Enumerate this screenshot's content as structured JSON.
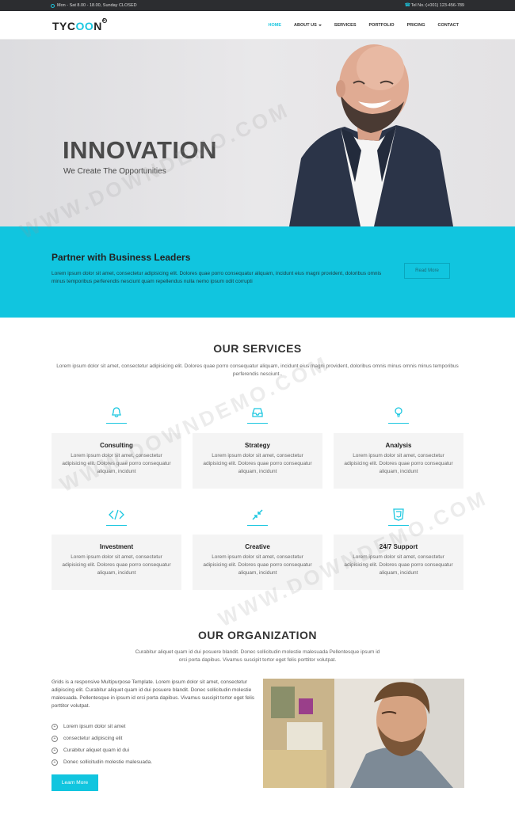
{
  "topbar": {
    "hours": "Mon - Sat 8.00 - 18.00, Sunday CLOSED",
    "phone": "Tel No.:(+001) 123-456-789"
  },
  "brand": {
    "pre": "TYC",
    "accent": "OO",
    "post": "N",
    "reg": "R"
  },
  "nav": [
    {
      "label": "HOME",
      "active": true
    },
    {
      "label": "ABOUT US"
    },
    {
      "label": "SERVICES"
    },
    {
      "label": "PORTFOLIO"
    },
    {
      "label": "PRICING"
    },
    {
      "label": "CONTACT"
    }
  ],
  "hero": {
    "title": "INNOVATION",
    "subtitle": "We Create The Opportunities"
  },
  "partner": {
    "title": "Partner with Business Leaders",
    "text": "Lorem ipsum dolor sit amet, consectetur adipisicing elit. Dolores quae porro consequatur aliquam, incidunt eius magni provident, doloribus omnis minus temporibus perferendis nesciunt quam repellendus nulla nemo ipsum odit corrupti",
    "button": "Read More"
  },
  "services": {
    "title": "OUR SERVICES",
    "desc": "Lorem ipsum dolor sit amet, consectetur adipisicing elit. Dolores quae porro consequatur aliquam, incidunt eius magni provident, doloribus omnis minus omnis minus temporibus perferendis nesciunt..",
    "items": [
      {
        "title": "Consulting",
        "text": "Lorem ipsum dolor sit amet, consectetur adipisicing elit. Dolores quae porro consequatur aliquam, incidunt",
        "icon": "bell-icon"
      },
      {
        "title": "Strategy",
        "text": "Lorem ipsum dolor sit amet, consectetur adipisicing elit. Dolores quae porro consequatur aliquam, incidunt",
        "icon": "inbox-icon"
      },
      {
        "title": "Analysis",
        "text": "Lorem ipsum dolor sit amet, consectetur adipisicing elit. Dolores quae porro consequatur aliquam, incidunt",
        "icon": "lightbulb-icon"
      },
      {
        "title": "Investment",
        "text": "Lorem ipsum dolor sit amet, consectetur adipisicing elit. Dolores quae porro consequatur aliquam, incidunt",
        "icon": "code-icon"
      },
      {
        "title": "Creative",
        "text": "Lorem ipsum dolor sit amet, consectetur adipisicing elit. Dolores quae porro consequatur aliquam, incidunt",
        "icon": "compress-icon"
      },
      {
        "title": "24/7 Support",
        "text": "Lorem ipsum dolor sit amet, consectetur adipisicing elit. Dolores quae porro consequatur aliquam, incidunt",
        "icon": "html5-icon"
      }
    ]
  },
  "organization": {
    "title": "OUR ORGANIZATION",
    "desc": "Curabitur aliquet quam id dui posuere blandit. Donec sollicitudin molestie malesuada Pellentesque ipsum id orci porta dapibus. Vivamus suscipit tortor eget felis porttitor volutpat.",
    "text": "Grids is a responsive Multipurpose Template. Lorem ipsum dolor sit amet, consectetur adipiscing elit. Curabitur aliquet quam id dui posuere blandit. Donec sollicitudin molestie malesuada. Pellentesque in ipsum id orci porta dapibus. Vivamus suscipit tortor eget felis porttitor volutpat.",
    "list": [
      "Lorem ipsum dolor sit amet",
      "consectetur adipiscing elit",
      "Curabitur aliquet quam id dui",
      "Donec sollicitudin molestie malesuada."
    ],
    "button": "Learn More"
  },
  "watermark": "WWW.DOWNDEMO.COM",
  "colors": {
    "accent": "#11c5df",
    "dark": "#2c2d30"
  }
}
